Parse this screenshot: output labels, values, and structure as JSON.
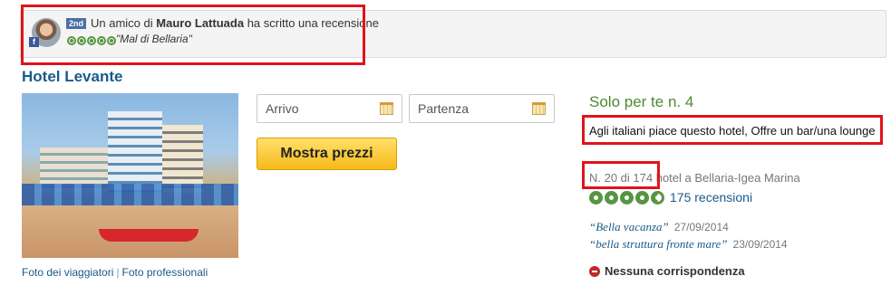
{
  "social": {
    "friend_prefix": "Un amico di",
    "friend_name": "Mauro Lattuada",
    "friend_suffix": "ha scritto una recensione",
    "degree_badge": "2nd",
    "fb_badge": "f",
    "review_title": "\"Mal di Bellaria\"",
    "review_rating": 5
  },
  "hotel": {
    "name": "Hotel Levante",
    "photo_links": [
      "Foto dei viaggiatori",
      "Foto professionali"
    ],
    "photo_separator": "|"
  },
  "booking": {
    "checkin_placeholder": "Arrivo",
    "checkout_placeholder": "Partenza",
    "show_prices_label": "Mostra prezzi"
  },
  "details": {
    "solo_label": "Solo per te n. 4",
    "tags_text": "Agli italiani piace questo hotel, Offre un bar/una lounge",
    "rank_text": "N. 20 di 174 hotel a Bellaria-Igea Marina",
    "rating_bubbles": 4.5,
    "reviews_link": "175 recensioni",
    "snippets": [
      {
        "quote": "Bella vacanza",
        "date": "27/09/2014"
      },
      {
        "quote": "bella struttura fronte mare",
        "date": "23/09/2014"
      }
    ],
    "no_match": "Nessuna corrispondenza"
  },
  "colors": {
    "highlight": "#e0131b",
    "link": "#1a5a8a",
    "rating_green": "#589442",
    "solo_green": "#4f8a2e",
    "button_yellow": "#f6b91a"
  },
  "icons": [
    "calendar-icon",
    "bubble-rating-icon",
    "no-match-icon",
    "facebook-icon"
  ]
}
